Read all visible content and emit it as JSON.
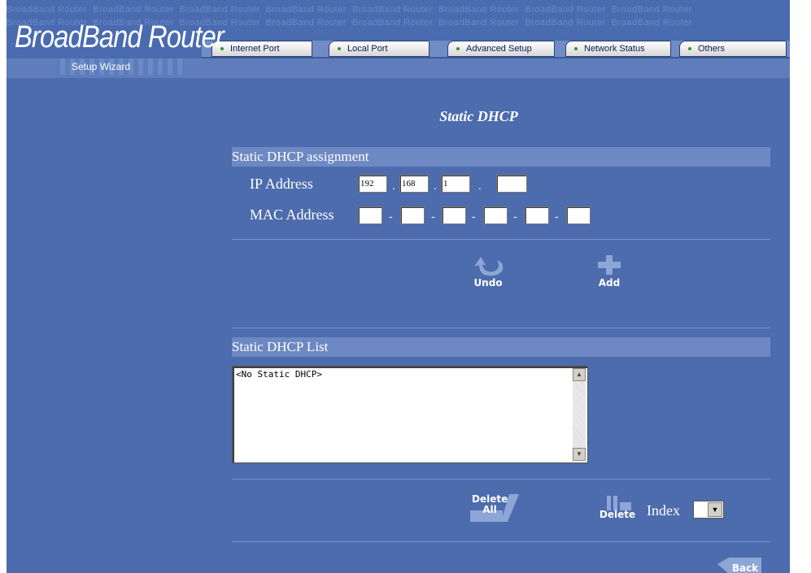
{
  "header": {
    "brand": "BroadBand Router",
    "wizard_label": "Setup Wizard",
    "watermark": "BroadBand Router"
  },
  "nav": {
    "tabs": [
      {
        "label": "Internet Port"
      },
      {
        "label": "Local Port"
      },
      {
        "label": "Advanced Setup"
      },
      {
        "label": "Network Status"
      },
      {
        "label": "Others"
      }
    ]
  },
  "page": {
    "title": "Static DHCP",
    "assignment": {
      "heading": "Static DHCP assignment",
      "ip_label": "IP Address",
      "ip_octets": [
        "192",
        "168",
        "1",
        ""
      ],
      "ip_separator": ".",
      "mac_label": "MAC Address",
      "mac_octets": [
        "",
        "",
        "",
        "",
        "",
        ""
      ],
      "mac_separator": "-"
    },
    "buttons": {
      "undo": "Undo",
      "add": "Add"
    },
    "list": {
      "heading": "Static DHCP List",
      "items": [
        "<No Static DHCP>"
      ]
    },
    "list_buttons": {
      "delete_all_line1": "Delete",
      "delete_all_line2": "All",
      "delete": "Delete",
      "index_label": "Index",
      "back": "Back"
    }
  },
  "colors": {
    "background": "#4d6cad",
    "section_bar": "#6d88c3",
    "tab_dot": "#2d9a2d"
  }
}
